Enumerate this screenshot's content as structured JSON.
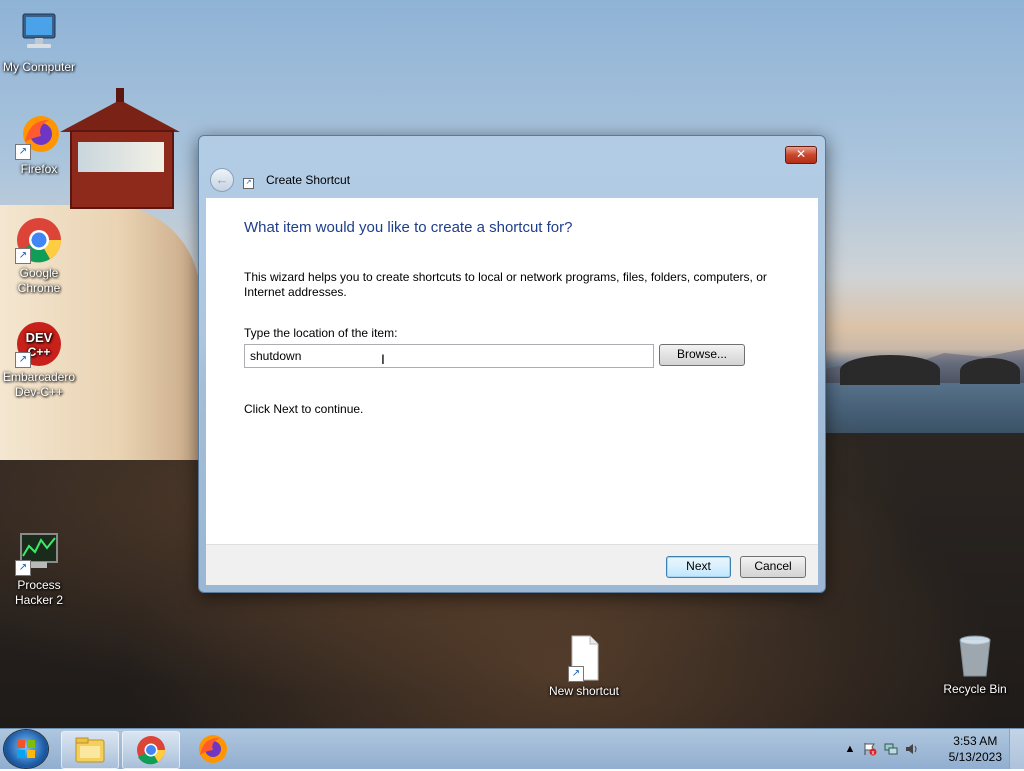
{
  "desktop": {
    "icons": [
      {
        "label": "My Computer"
      },
      {
        "label": "Firefox"
      },
      {
        "label": "Google Chrome"
      },
      {
        "label": "Embarcadero Dev-C++"
      },
      {
        "label": "Process Hacker 2"
      },
      {
        "label": "New shortcut"
      },
      {
        "label": "Recycle Bin"
      }
    ]
  },
  "dialog": {
    "title": "Create Shortcut",
    "close_label": "✕",
    "heading": "What item would you like to create a shortcut for?",
    "description": "This wizard helps you to create shortcuts to local or network programs, files, folders, computers, or Internet addresses.",
    "location_label": "Type the location of the item:",
    "location_value": "shutdown",
    "browse_label": "Browse...",
    "continue_hint": "Click Next to continue.",
    "next_label": "Next",
    "cancel_label": "Cancel"
  },
  "taskbar": {
    "pinned": [
      {
        "icon": "file-explorer-icon"
      },
      {
        "icon": "chrome-icon"
      },
      {
        "icon": "firefox-icon"
      }
    ],
    "clock": {
      "time": "3:53 AM",
      "date": "5/13/2023"
    }
  },
  "colors": {
    "heading_blue": "#1e3e8c",
    "close_red": "#c8452b",
    "taskbar": "#8caacd"
  }
}
